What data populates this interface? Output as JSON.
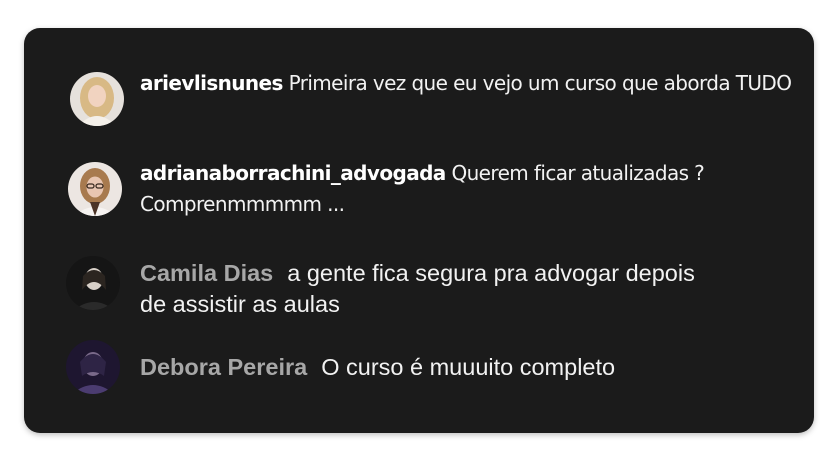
{
  "comments": [
    {
      "username": "arievlisnunes",
      "text": "Primeira vez que eu vejo um curso que aborda TUDO",
      "avatar_icon": "user-avatar-blonde-woman"
    },
    {
      "username": "adrianaborrachini_advogada",
      "text": "Querem ficar atualizadas ? Comprenmmmmm ...",
      "avatar_icon": "user-avatar-woman-glasses"
    },
    {
      "username": "Camila Dias",
      "text": "a gente fica segura pra advogar depois de assistir as aulas",
      "avatar_icon": "user-avatar-woman-dark"
    },
    {
      "username": "Debora Pereira",
      "text": "O curso é muuuito completo",
      "avatar_icon": "user-avatar-woman-purple"
    }
  ],
  "colors": {
    "panel_bg": "#1b1b1b",
    "text": "#f2f2f2",
    "username_muted": "#a7a7a7"
  }
}
